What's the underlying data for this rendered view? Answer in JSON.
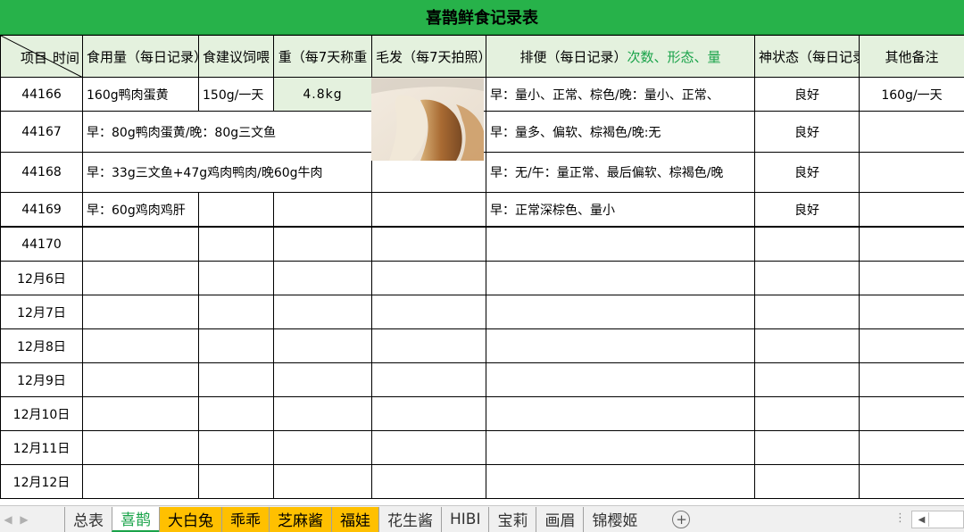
{
  "title": "喜鹊鲜食记录表",
  "header": {
    "diag_a": "项目",
    "diag_b": "时间",
    "col_food": "食用量（每日记录）",
    "col_suggest": "食建议饲喂",
    "col_weight": "重（每7天称重",
    "col_fur": "毛发（每7天拍照）",
    "col_stool_main": "排便（每日记录）",
    "col_stool_accent": "次数、形态、量",
    "col_mood": "神状态（每日记录",
    "col_notes": "其他备注"
  },
  "rows": [
    {
      "id": "44166",
      "food": "160g鸭肉蛋黄",
      "suggest": "150g/一天",
      "weight": "4.8kg",
      "stool": "早：量小、正常、棕色/晚：量小、正常、",
      "mood": "良好",
      "notes": "160g/一天"
    },
    {
      "id": "44167",
      "food": "早：80g鸭肉蛋黄/晚：80g三文鱼",
      "stool": "早：量多、偏软、棕褐色/晚:无",
      "mood": "良好"
    },
    {
      "id": "44168",
      "food": "早：33g三文鱼+47g鸡肉鸭肉/晚60g牛肉",
      "stool": "早：无/午：量正常、最后偏软、棕褐色/晚",
      "mood": "良好"
    },
    {
      "id": "44169",
      "food": "早：60g鸡肉鸡肝",
      "stool": "早：正常深棕色、量小",
      "mood": "良好"
    }
  ],
  "date_rows": [
    "44170",
    "12月6日",
    "12月7日",
    "12月8日",
    "12月9日",
    "12月10日",
    "12月11日",
    "12月12日"
  ],
  "tabs": [
    {
      "label": "总表",
      "style": "normal"
    },
    {
      "label": "喜鹊",
      "style": "active"
    },
    {
      "label": "大白兔",
      "style": "yellow"
    },
    {
      "label": "乖乖",
      "style": "yellow"
    },
    {
      "label": "芝麻酱",
      "style": "yellow"
    },
    {
      "label": "福娃",
      "style": "yellow"
    },
    {
      "label": "花生酱",
      "style": "normal"
    },
    {
      "label": "HIBI",
      "style": "normal"
    },
    {
      "label": "宝莉",
      "style": "normal"
    },
    {
      "label": "画眉",
      "style": "normal"
    },
    {
      "label": "锦樱姬",
      "style": "normal"
    }
  ],
  "photo_icon": "cat-fur-photo",
  "colors": {
    "title_bg": "#27b24a",
    "header_bg": "#e4f1de",
    "accent": "#1aa34a",
    "tab_yellow": "#ffc000"
  }
}
